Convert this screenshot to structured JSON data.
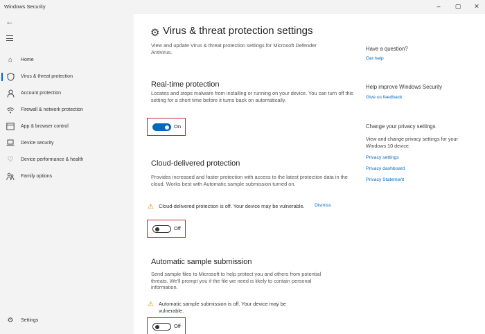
{
  "window": {
    "title": "Windows Security"
  },
  "sidebar": {
    "items": [
      {
        "label": "Home",
        "icon": "home-icon"
      },
      {
        "label": "Virus & threat protection",
        "icon": "shield-icon"
      },
      {
        "label": "Account protection",
        "icon": "person-icon"
      },
      {
        "label": "Firewall & network protection",
        "icon": "wifi-icon"
      },
      {
        "label": "App & browser control",
        "icon": "browser-icon"
      },
      {
        "label": "Device security",
        "icon": "laptop-icon"
      },
      {
        "label": "Device performance & health",
        "icon": "heart-icon"
      },
      {
        "label": "Family options",
        "icon": "family-icon"
      }
    ],
    "settings_label": "Settings"
  },
  "main": {
    "title": "Virus & threat protection settings",
    "description": "View and update Virus & threat protection settings for Microsoft Defender Antivirus.",
    "sections": [
      {
        "title": "Real-time protection",
        "description": "Locates and stops malware from installing or running on your device. You can turn off this setting for a short time before it turns back on automatically.",
        "toggle_state": "On"
      },
      {
        "title": "Cloud-delivered protection",
        "description": "Provides increased and faster protection with access to the latest protection data in the cloud. Works best with Automatic sample submission turned on.",
        "warning": "Cloud-delivered protection is off. Your device may be vulnerable.",
        "dismiss": "Dismiss",
        "toggle_state": "Off"
      },
      {
        "title": "Automatic sample submission",
        "description": "Send sample files to Microsoft to help protect you and others from potential threats. We'll prompt you if the file we need is likely to contain personal information.",
        "warning": "Automatic sample submission is off. Your device may be vulnerable.",
        "toggle_state": "Off"
      }
    ]
  },
  "aside": {
    "question_title": "Have a question?",
    "get_help": "Get help",
    "improve_title": "Help improve Windows Security",
    "feedback": "Give us feedback",
    "privacy_title": "Change your privacy settings",
    "privacy_text": "View and change privacy settings for your Windows 10 device.",
    "links": [
      "Privacy settings",
      "Privacy dashboard",
      "Privacy Statement"
    ]
  },
  "colors": {
    "accent": "#0067c0",
    "highlight_box": "#c62828",
    "warning": "#c28a00",
    "sidebar_bg": "#f3f3f3"
  }
}
